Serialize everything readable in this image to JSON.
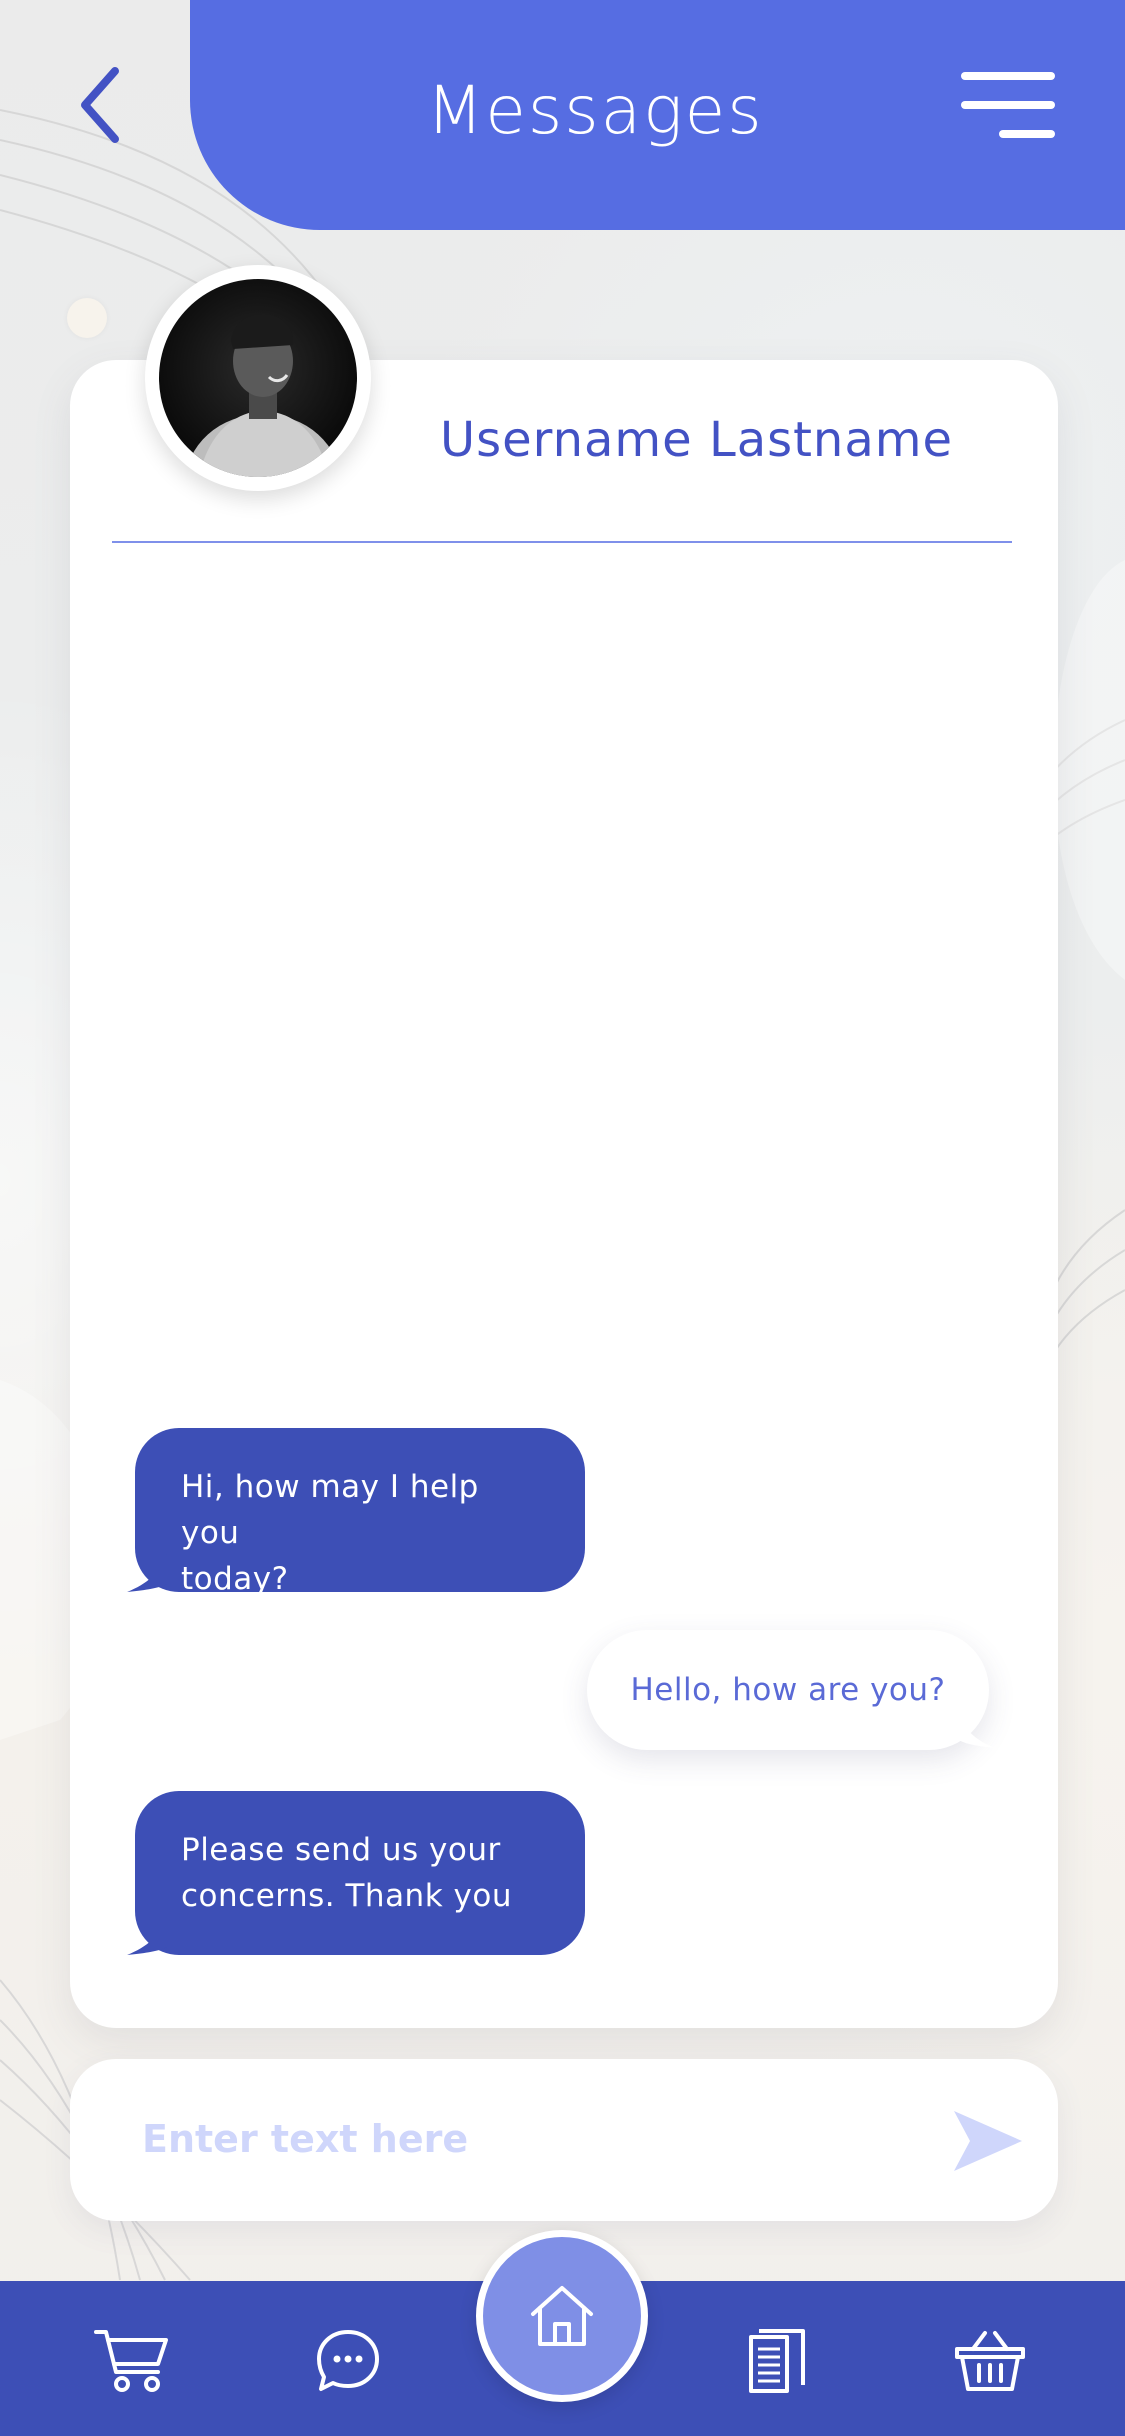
{
  "header": {
    "title": "Messages",
    "back_icon": "chevron-left-icon",
    "menu_icon": "hamburger-menu-icon"
  },
  "contact": {
    "name": "Username Lastname",
    "avatar": "avatar-photo"
  },
  "messages": [
    {
      "direction": "incoming",
      "text": "Hi, how may I help you\ntoday?"
    },
    {
      "direction": "outgoing",
      "text": "Hello, how are you?"
    },
    {
      "direction": "incoming",
      "text": "Please send us your\nconcerns. Thank you"
    }
  ],
  "composer": {
    "placeholder": "Enter text here",
    "value": "",
    "send_icon": "send-arrow-icon"
  },
  "bottom_nav": {
    "items": [
      {
        "icon": "cart-icon"
      },
      {
        "icon": "chat-bubble-icon"
      },
      {
        "icon": "home-icon"
      },
      {
        "icon": "documents-icon"
      },
      {
        "icon": "basket-icon"
      }
    ]
  },
  "colors": {
    "header": "#566de2",
    "incoming_bubble": "#3d4fb6",
    "outgoing_text": "#5a6ad6",
    "nav_bar": "#3d4fb6",
    "home_button": "#7f8fe6",
    "placeholder": "#cfd6fb"
  }
}
